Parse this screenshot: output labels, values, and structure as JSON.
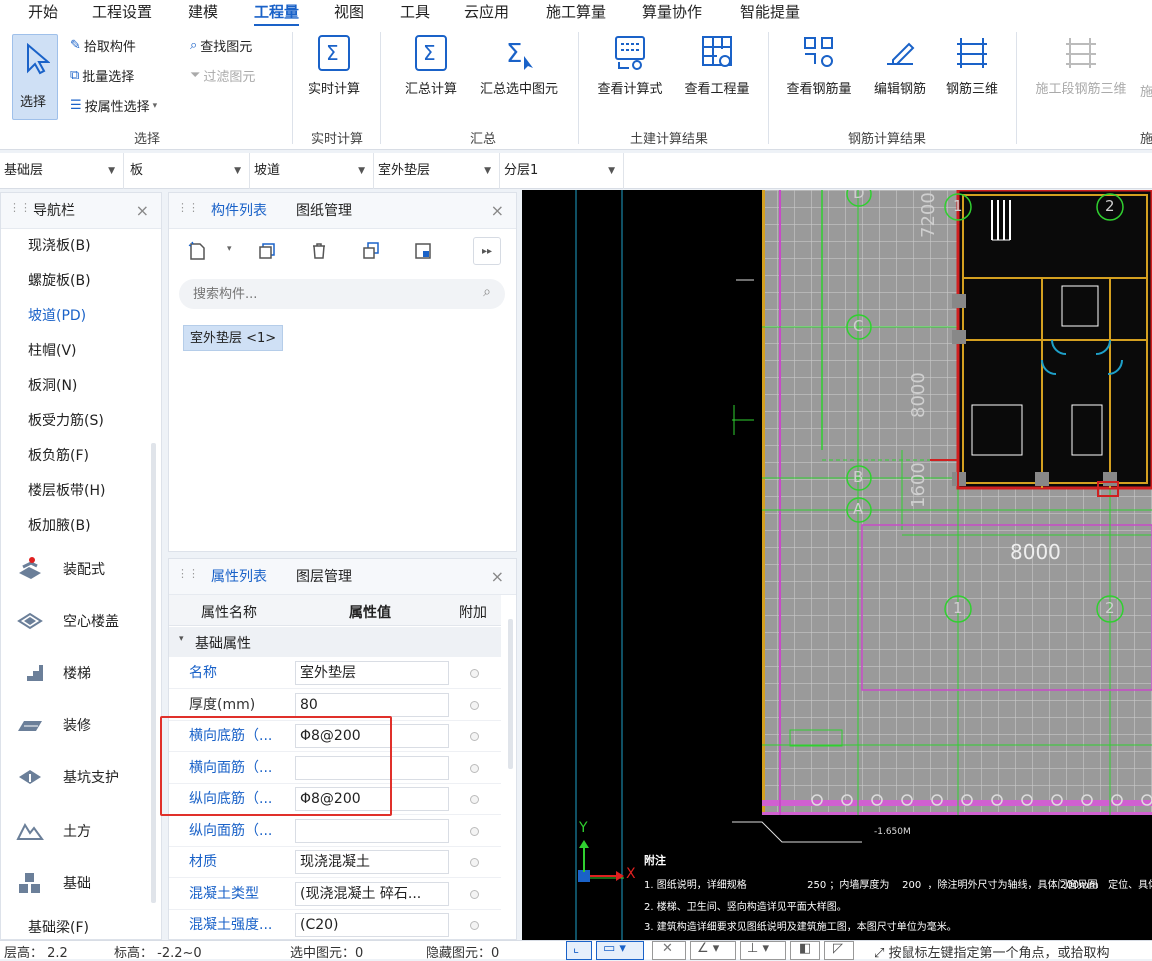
{
  "menu": {
    "items": [
      "开始",
      "工程设置",
      "建模",
      "工程量",
      "视图",
      "工具",
      "云应用",
      "施工算量",
      "算量协作",
      "智能提量"
    ],
    "active": "工程量"
  },
  "ribbon": {
    "select": {
      "big": "选择",
      "pick": "拾取构件",
      "batch": "批量选择",
      "byprop": "按属性选择",
      "find": "查找图元",
      "filter": "过滤图元",
      "group": "选择"
    },
    "realtime": {
      "label": "实时计算",
      "group": "实时计算"
    },
    "summary": {
      "calc": "汇总计算",
      "calc_sel": "汇总选中图元",
      "group": "汇总"
    },
    "civil": {
      "formula": "查看计算式",
      "quantity": "查看工程量",
      "group": "土建计算结果"
    },
    "rebar": {
      "view": "查看钢筋量",
      "edit": "编辑钢筋",
      "threed": "钢筋三维",
      "group": "钢筋计算结果"
    },
    "stage": {
      "label": "施工段钢筋三维",
      "label2": "施",
      "group": "施"
    }
  },
  "layerbar": {
    "floor": "基础层",
    "type": "板",
    "sub": "坡道",
    "comp": "室外垫层",
    "layer": "分层1"
  },
  "nav": {
    "title": "导航栏",
    "items": [
      "现浇板(B)",
      "螺旋板(B)",
      "坡道(PD)",
      "柱帽(V)",
      "板洞(N)",
      "板受力筋(S)",
      "板负筋(F)",
      "楼层板带(H)",
      "板加腋(B)"
    ],
    "selected_index": 2,
    "categories": [
      "装配式",
      "空心楼盖",
      "楼梯",
      "装修",
      "基坑支护",
      "土方",
      "基础"
    ],
    "last_item": "基础梁(F)"
  },
  "comp_list": {
    "tab1": "构件列表",
    "tab2": "图纸管理",
    "search_placeholder": "搜索构件...",
    "item": "室外垫层 <1>"
  },
  "props": {
    "tab1": "属性列表",
    "tab2": "图层管理",
    "col_name": "属性名称",
    "col_val": "属性值",
    "col_extra": "附加",
    "section": "基础属性",
    "rows": [
      {
        "name": "名称",
        "value": "室外垫层"
      },
      {
        "name": "厚度(mm)",
        "value": "80"
      },
      {
        "name": "横向底筋（...",
        "value": "Φ8@200"
      },
      {
        "name": "横向面筋（...",
        "value": ""
      },
      {
        "name": "纵向底筋（...",
        "value": "Φ8@200"
      },
      {
        "name": "纵向面筋（...",
        "value": ""
      },
      {
        "name": "材质",
        "value": "现浇混凝土"
      },
      {
        "name": "混凝土类型",
        "value": "(现浇混凝土  碎石..."
      },
      {
        "name": "混凝土强度...",
        "value": "(C20)"
      }
    ]
  },
  "cad": {
    "dims": [
      "7200",
      "8000",
      "1600",
      "8000"
    ],
    "axes_letters": [
      "D",
      "C",
      "B",
      "A"
    ],
    "axes_numbers": [
      "1",
      "2"
    ],
    "note_title": "附注",
    "notes": [
      "1. 图纸说明，详细规格                   250 ；内墙厚度为    200  ，除注明外尺寸为轴线，具体门窗见图",
      "2. 楼梯、卫生间、竖向构造详见平面大样图。",
      "3. 建筑构造详细要求见图纸说明及建筑施工图，本图尺寸单位为毫米。"
    ],
    "note_right": "200mm   定位、具体见",
    "elev": "-1.650M",
    "axis_x": "X",
    "axis_y": "Y"
  },
  "status": {
    "floor_h": "层高：  2.2",
    "elev": "标高：  -2.2~0",
    "sel": "选中图元：0",
    "hidden": "隐藏图元：0",
    "hint": "按鼠标左键指定第一个角点，或拾取构"
  },
  "colors": {
    "accent": "#1a62c8",
    "highlight_box": "#e0302a",
    "cad_bg": "#000000"
  }
}
